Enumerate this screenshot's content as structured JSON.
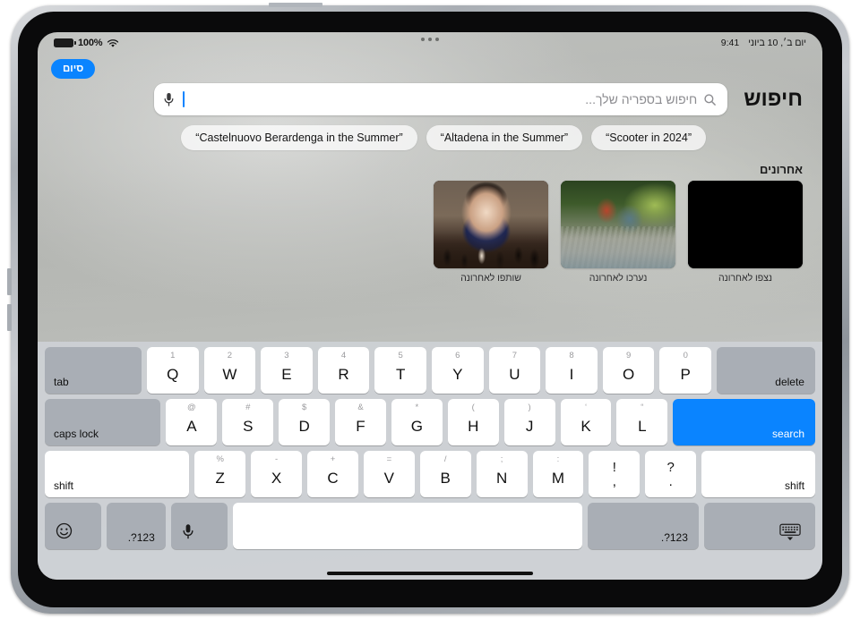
{
  "status_bar": {
    "battery_percent": "100%",
    "battery_icon": "battery-full-icon",
    "wifi_icon": "wifi-icon",
    "time": "9:41",
    "date": "יום ב׳, 10 ביוני"
  },
  "multitask": {
    "handle_icon": "multitasking-dots-icon"
  },
  "done_button": {
    "label": "סיום"
  },
  "header": {
    "title": "חיפוש"
  },
  "search": {
    "placeholder": "חיפוש בספריה שלך...",
    "value": "",
    "magnify_icon": "search-icon",
    "mic_icon": "microphone-icon"
  },
  "suggestions": [
    {
      "label": "“Scooter in 2024”"
    },
    {
      "label": "“Altadena in the Summer”"
    },
    {
      "label": "“Castelnuovo Berardenga in the Summer”"
    }
  ],
  "recents": {
    "heading": "אחרונים",
    "items": [
      {
        "caption": "נצפו לאחרונה",
        "art": "art-black"
      },
      {
        "caption": "נערכו לאחרונה",
        "art": "art-creek"
      },
      {
        "caption": "שותפו לאחרונה",
        "art": "art-chess"
      }
    ]
  },
  "keyboard": {
    "row1": [
      {
        "main": "tab",
        "type": "mod-dark-bl"
      },
      {
        "sub": "1",
        "main": "Q"
      },
      {
        "sub": "2",
        "main": "W"
      },
      {
        "sub": "3",
        "main": "E"
      },
      {
        "sub": "4",
        "main": "R"
      },
      {
        "sub": "5",
        "main": "T"
      },
      {
        "sub": "6",
        "main": "Y"
      },
      {
        "sub": "7",
        "main": "U"
      },
      {
        "sub": "8",
        "main": "I"
      },
      {
        "sub": "9",
        "main": "O"
      },
      {
        "sub": "0",
        "main": "P"
      },
      {
        "main": "delete",
        "type": "mod-dark-br"
      }
    ],
    "row2": [
      {
        "main": "caps lock",
        "type": "mod-dark-bl"
      },
      {
        "sub": "@",
        "main": "A"
      },
      {
        "sub": "#",
        "main": "S"
      },
      {
        "sub": "$",
        "main": "D"
      },
      {
        "sub": "&",
        "main": "F"
      },
      {
        "sub": "*",
        "main": "G"
      },
      {
        "sub": "(",
        "main": "H"
      },
      {
        "sub": ")",
        "main": "J"
      },
      {
        "sub": "‘",
        "main": "K"
      },
      {
        "sub": "“",
        "main": "L"
      },
      {
        "main": "search",
        "type": "return-blue"
      }
    ],
    "row3": [
      {
        "main": "shift",
        "type": "mod-light-bl"
      },
      {
        "sub": "%",
        "main": "Z"
      },
      {
        "sub": "-",
        "main": "X"
      },
      {
        "sub": "+",
        "main": "C"
      },
      {
        "sub": "=",
        "main": "V"
      },
      {
        "sub": "/",
        "main": "B"
      },
      {
        "sub": ";",
        "main": "N"
      },
      {
        "sub": ":",
        "main": "M"
      },
      {
        "top": "!",
        "bot": ",",
        "type": "dual"
      },
      {
        "top": "?",
        "bot": ".",
        "type": "dual"
      },
      {
        "main": "shift",
        "type": "mod-light-br"
      }
    ],
    "row4": [
      {
        "main": "☺",
        "type": "ctl-emoji",
        "icon": "emoji-icon"
      },
      {
        "main": ".?123",
        "type": "ctl-num"
      },
      {
        "main": "",
        "type": "ctl-mic",
        "icon": "microphone-icon"
      },
      {
        "main": "",
        "type": "space"
      },
      {
        "main": ".?123",
        "type": "ctl-num2"
      },
      {
        "main": "",
        "type": "ctl-kbd",
        "icon": "dismiss-keyboard-icon"
      }
    ]
  },
  "home_indicator": {
    "label": "home-indicator"
  },
  "colors": {
    "accent_blue": "#0a84ff",
    "key_white": "#ffffff",
    "key_dark": "#a9aeb5",
    "keyboard_bg": "#ced1d5"
  }
}
